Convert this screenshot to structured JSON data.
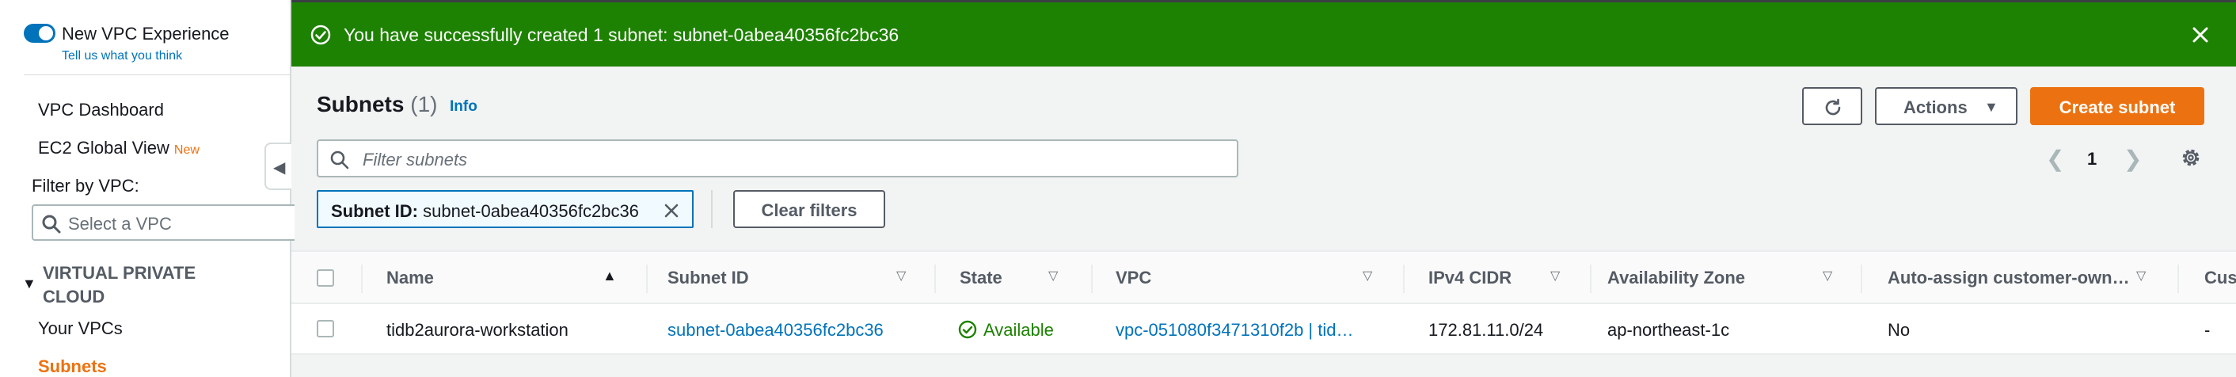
{
  "sidebar": {
    "toggle_label": "New VPC Experience",
    "toggle_link": "Tell us what you think",
    "items": [
      {
        "label": "VPC Dashboard"
      },
      {
        "label": "EC2 Global View",
        "badge": "New"
      }
    ],
    "filter_label": "Filter by VPC:",
    "vpc_select_placeholder": "Select a VPC",
    "section_title": "VIRTUAL PRIVATE CLOUD",
    "section_items": [
      {
        "label": "Your VPCs"
      },
      {
        "label": "Subnets",
        "active": true
      }
    ]
  },
  "flash": {
    "message": "You have successfully created 1 subnet: subnet-0abea40356fc2bc36",
    "color": "#1d8102",
    "icon": "check-circle-icon"
  },
  "header": {
    "title": "Subnets",
    "count": "(1)",
    "info": "Info",
    "actions_label": "Actions",
    "create_label": "Create subnet",
    "accent": "#ec7211"
  },
  "filter": {
    "placeholder": "Filter subnets",
    "token_key": "Subnet ID:",
    "token_value": "subnet-0abea40356fc2bc36",
    "clear_label": "Clear filters"
  },
  "pagination": {
    "current": "1"
  },
  "table": {
    "columns": [
      "Name",
      "Subnet ID",
      "State",
      "VPC",
      "IPv4 CIDR",
      "Availability Zone",
      "Auto-assign customer-own…",
      "Cus"
    ],
    "rows": [
      {
        "name": "tidb2aurora-workstation",
        "subnet_id": "subnet-0abea40356fc2bc36",
        "state": "Available",
        "vpc": "vpc-051080f3471310f2b | tid…",
        "cidr": "172.81.11.0/24",
        "az": "ap-northeast-1c",
        "auto_assign": "No",
        "cus": "-"
      }
    ]
  }
}
